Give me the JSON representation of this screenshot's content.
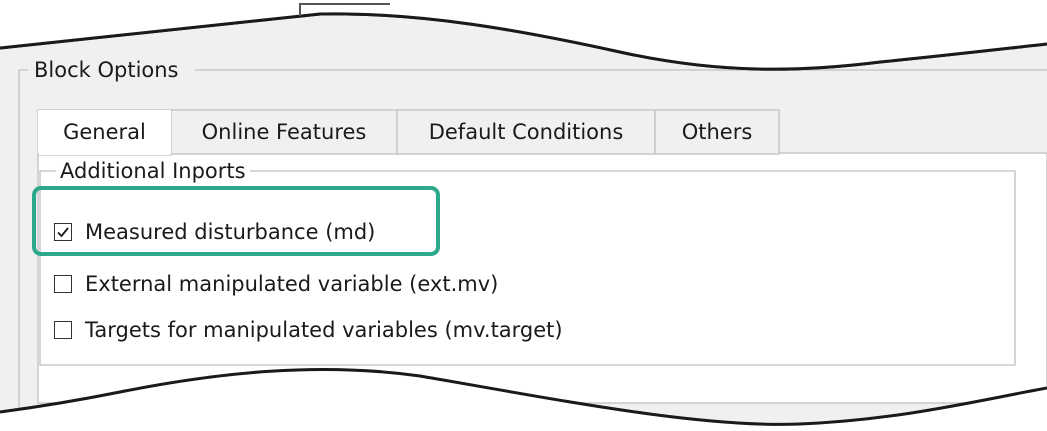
{
  "dialog": {
    "group_title": "Block Options",
    "tabs": [
      {
        "label": "General",
        "active": true
      },
      {
        "label": "Online Features",
        "active": false
      },
      {
        "label": "Default Conditions",
        "active": false
      },
      {
        "label": "Others",
        "active": false
      }
    ],
    "section_title": "Additional Inports",
    "checkboxes": [
      {
        "label": "Measured disturbance (md)",
        "checked": true,
        "highlighted": true
      },
      {
        "label": "External manipulated variable (ext.mv)",
        "checked": false
      },
      {
        "label": "Targets for manipulated variables (mv.target)",
        "checked": false
      }
    ]
  },
  "colors": {
    "dialog_background": "#f0f0f0",
    "panel_background": "#ffffff",
    "border": "#c8c8c8",
    "highlight": "#2aa98c",
    "torn_edge": "#1a1a1a"
  }
}
